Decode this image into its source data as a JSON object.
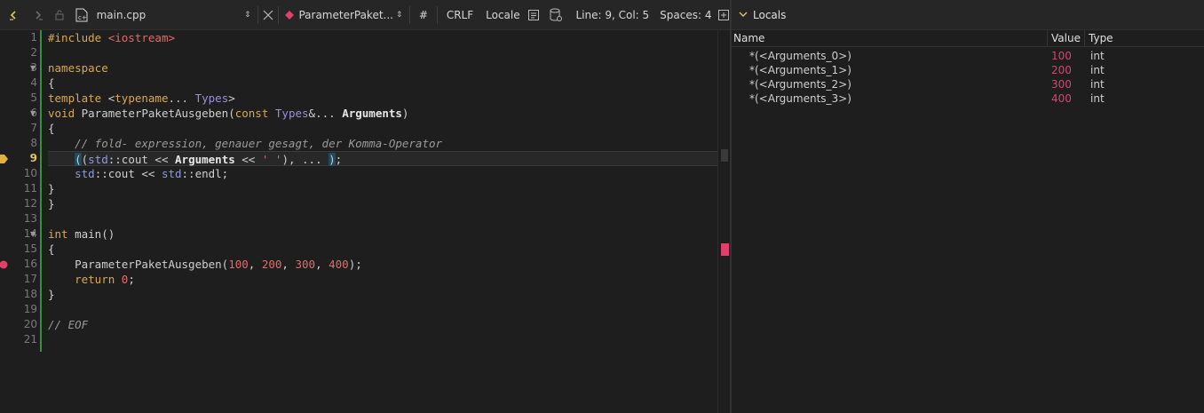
{
  "toolbar": {
    "file_name": "main.cpp",
    "function_name": "ParameterPaket...",
    "hash": "#",
    "line_ending": "CRLF",
    "encoding": "Locale",
    "position": "Line: 9, Col: 5",
    "indent": "Spaces: 4"
  },
  "editor": {
    "line_numbers": [
      "1",
      "2",
      "3",
      "4",
      "5",
      "6",
      "7",
      "8",
      "9",
      "10",
      "11",
      "12",
      "13",
      "14",
      "15",
      "16",
      "17",
      "18",
      "19",
      "20",
      "21"
    ],
    "current_line": "9",
    "breakpoint_line": "16"
  },
  "locals": {
    "title": "Locals",
    "columns": {
      "name": "Name",
      "value": "Value",
      "type": "Type"
    },
    "rows": [
      {
        "name": "*(<Arguments_0>)",
        "value": "100",
        "type": "int"
      },
      {
        "name": "*(<Arguments_1>)",
        "value": "200",
        "type": "int"
      },
      {
        "name": "*(<Arguments_2>)",
        "value": "300",
        "type": "int"
      },
      {
        "name": "*(<Arguments_3>)",
        "value": "400",
        "type": "int"
      }
    ]
  },
  "colors": {
    "accent": "#e0406a",
    "change_bar": "#3d8c40",
    "current_line_number": "#e0c36a"
  }
}
